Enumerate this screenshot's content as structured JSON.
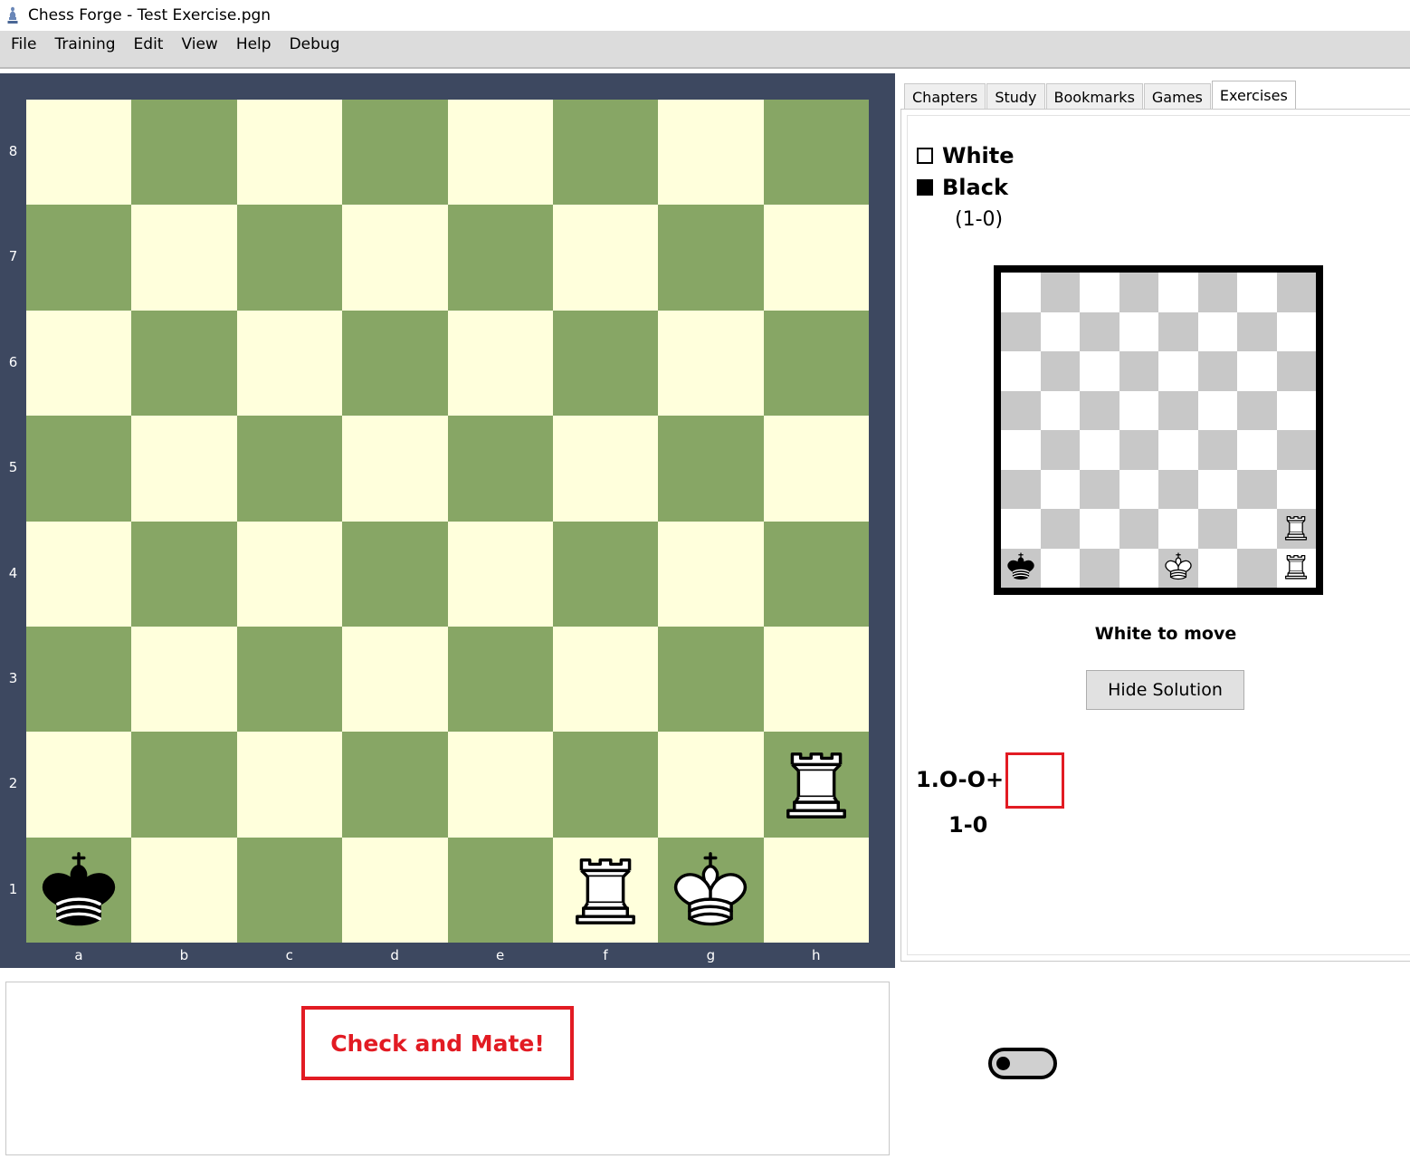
{
  "window": {
    "title": "Chess Forge - Test Exercise.pgn"
  },
  "menu": [
    "File",
    "Training",
    "Edit",
    "View",
    "Help",
    "Debug"
  ],
  "board": {
    "ranks": [
      "8",
      "7",
      "6",
      "5",
      "4",
      "3",
      "2",
      "1"
    ],
    "files": [
      "a",
      "b",
      "c",
      "d",
      "e",
      "f",
      "g",
      "h"
    ],
    "pieces": {
      "h2": "white-rook",
      "a1": "black-king",
      "f1": "white-rook",
      "g1": "white-king"
    }
  },
  "mini_board": {
    "pieces": {
      "h2": "white-rook",
      "a1": "black-king",
      "e1": "white-king",
      "h1": "white-rook"
    }
  },
  "tabs": [
    "Chapters",
    "Study",
    "Bookmarks",
    "Games",
    "Exercises"
  ],
  "active_tab": "Exercises",
  "exercise": {
    "white_label": "White",
    "black_label": "Black",
    "result_header": "(1-0)",
    "to_move": "White to move",
    "hide_solution": "Hide Solution",
    "move": "1.O-O+",
    "result": "1-0"
  },
  "message": "Check and Mate!",
  "colors": {
    "accent_red": "#e21b23",
    "board_light": "#ffffdc",
    "board_dark": "#87a665",
    "frame": "#3d4860"
  },
  "icons": {
    "app": "chess-bishop-icon",
    "toggle": "toggle-switch-icon"
  }
}
